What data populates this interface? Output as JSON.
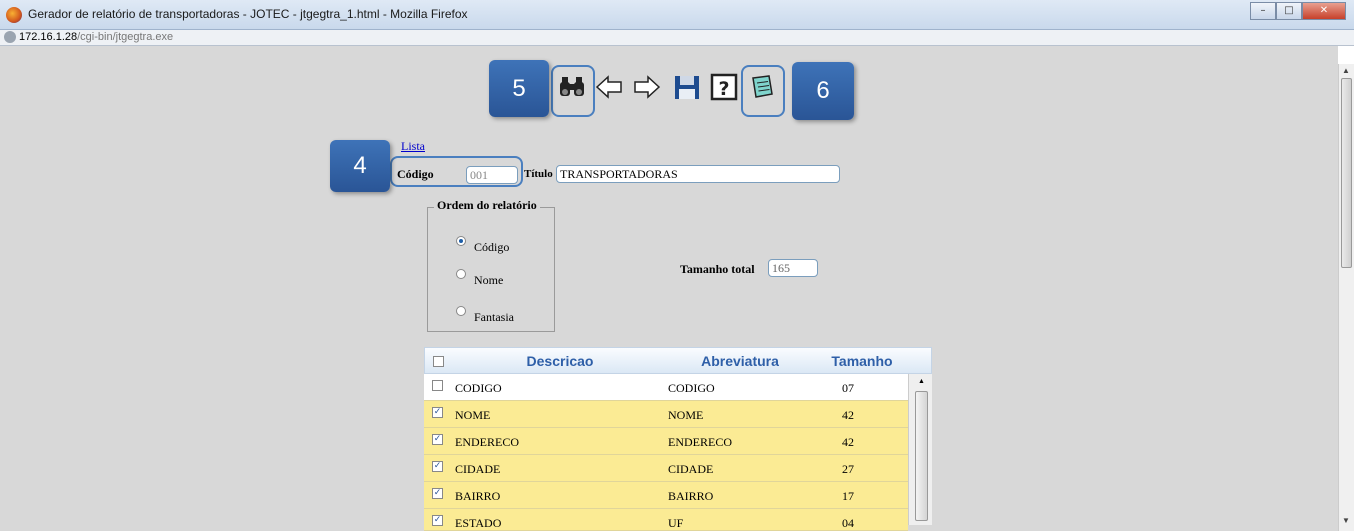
{
  "window": {
    "title": "Gerador de relatório de transportadoras - JOTEC - jtgegtra_1.html - Mozilla Firefox"
  },
  "address": {
    "host": "172.16.1.28",
    "path": "/cgi-bin/jtgegtra.exe"
  },
  "callouts": {
    "c4": "4",
    "c5": "5",
    "c6": "6"
  },
  "toolbar": {
    "search_icon": "binoculars-icon",
    "prev_icon": "arrow-left-icon",
    "next_icon": "arrow-right-icon",
    "save_icon": "floppy-icon",
    "help_icon": "help-icon",
    "generate_icon": "notepad-icon"
  },
  "form": {
    "lista_link": "Lista",
    "codigo_label": "Código",
    "codigo_value": "001",
    "titulo_label": "Título",
    "titulo_value": "TRANSPORTADORAS",
    "ordem_legend": "Ordem do relatório",
    "ordem_options": [
      {
        "label": "Código",
        "selected": true
      },
      {
        "label": "Nome",
        "selected": false
      },
      {
        "label": "Fantasia",
        "selected": false
      }
    ],
    "tamanho_label": "Tamanho total",
    "tamanho_value": "165"
  },
  "grid": {
    "headers": [
      "Descricao",
      "Abreviatura",
      "Tamanho"
    ],
    "rows": [
      {
        "descricao": "CODIGO",
        "abreviatura": "CODIGO",
        "tamanho": "07",
        "checked": false
      },
      {
        "descricao": "NOME",
        "abreviatura": "NOME",
        "tamanho": "42",
        "checked": true
      },
      {
        "descricao": "ENDERECO",
        "abreviatura": "ENDERECO",
        "tamanho": "42",
        "checked": true
      },
      {
        "descricao": "CIDADE",
        "abreviatura": "CIDADE",
        "tamanho": "27",
        "checked": true
      },
      {
        "descricao": "BAIRRO",
        "abreviatura": "BAIRRO",
        "tamanho": "17",
        "checked": true
      },
      {
        "descricao": "ESTADO",
        "abreviatura": "UF",
        "tamanho": "04",
        "checked": true
      }
    ]
  },
  "colors": {
    "row_selected": "#fbeb94",
    "row_unselected": "#ffffff",
    "callout": "#2f5fa3",
    "viewport_bg": "#d8d8d8"
  }
}
